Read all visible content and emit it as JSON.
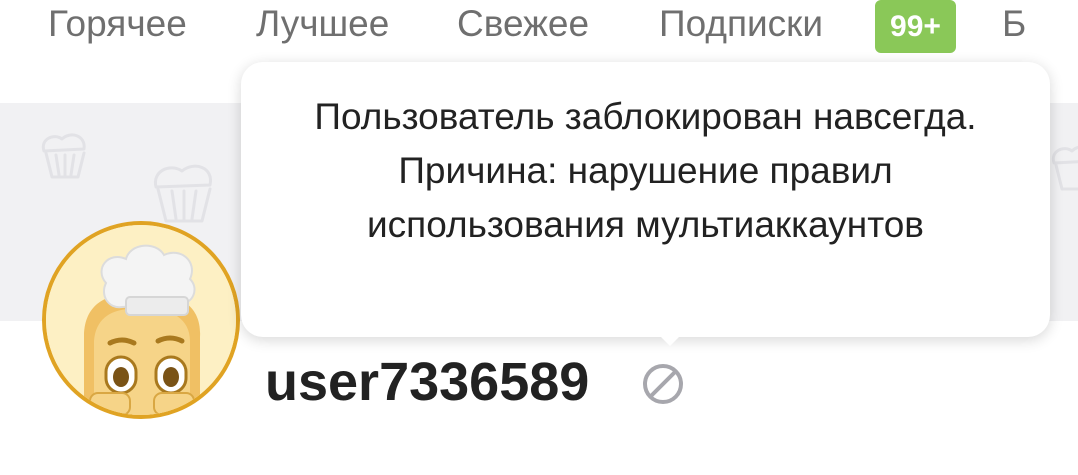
{
  "nav": {
    "tabs": [
      {
        "label": "Горячее"
      },
      {
        "label": "Лучшее"
      },
      {
        "label": "Свежее"
      },
      {
        "label": "Подписки",
        "badge": "99+"
      },
      {
        "label": "Б"
      }
    ]
  },
  "profile": {
    "username": "user7336589",
    "status_icon": "ban-icon",
    "avatar_icon": "chef-toast-avatar"
  },
  "tooltip": {
    "text": "Пользователь заблокирован навсегда. Причина: нарушение правил использования мультиаккаунтов"
  },
  "colors": {
    "badge": "#8ac858",
    "avatar_border": "#e0a323",
    "cover": "#f1f1f3",
    "nav_text": "#6f6f6f",
    "icon_gray": "#a7a7ad"
  }
}
